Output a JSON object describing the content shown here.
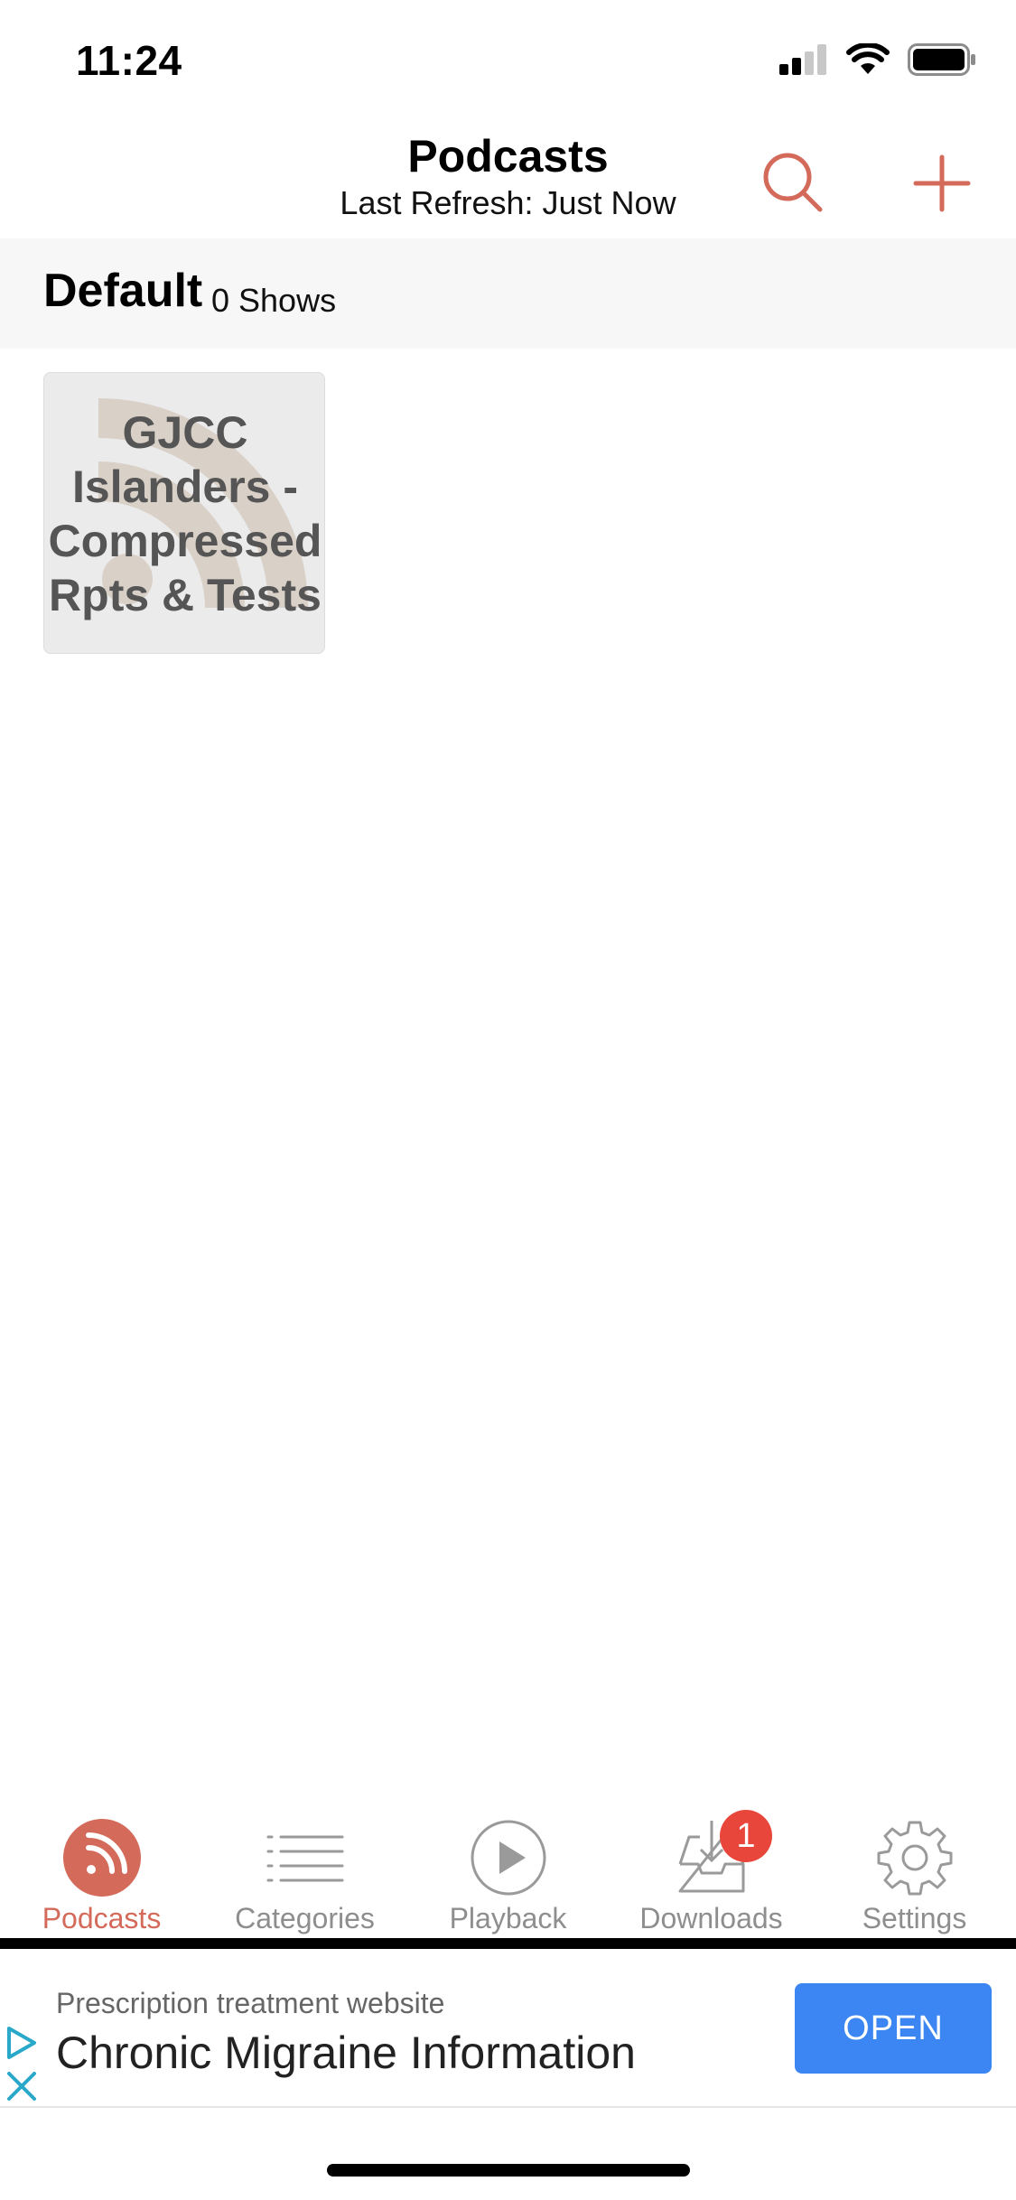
{
  "status_bar": {
    "time": "11:24",
    "icons": [
      "cellular-signal-icon",
      "wifi-icon",
      "battery-icon"
    ]
  },
  "header": {
    "title": "Podcasts",
    "subtitle": "Last Refresh: Just Now",
    "search_icon": "search-icon",
    "add_icon": "plus-icon"
  },
  "group": {
    "title": "Default",
    "count": "0 Shows"
  },
  "podcasts": [
    {
      "title": "GJCC Islanders - Compressed Rpts & Tests"
    }
  ],
  "tabbar": {
    "tabs": [
      {
        "label": "Podcasts",
        "icon": "rss-icon",
        "active": true
      },
      {
        "label": "Categories",
        "icon": "list-icon",
        "active": false
      },
      {
        "label": "Playback",
        "icon": "play-icon",
        "active": false
      },
      {
        "label": "Downloads",
        "icon": "download-tray-icon",
        "active": false,
        "badge": "1"
      },
      {
        "label": "Settings",
        "icon": "gear-icon",
        "active": false
      }
    ]
  },
  "ad": {
    "subtitle": "Prescription treatment website",
    "title": "Chronic Migraine Information",
    "cta": "OPEN"
  },
  "colors": {
    "accent": "#d46a5a",
    "inactive": "#8e8e8e",
    "badge": "#e8463a",
    "ad_button": "#3b86f2"
  }
}
